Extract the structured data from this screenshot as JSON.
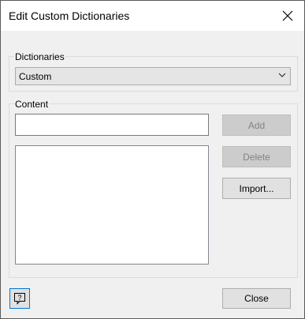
{
  "window": {
    "title": "Edit Custom Dictionaries",
    "close_icon": "close-icon"
  },
  "dictionaries": {
    "label": "Dictionaries",
    "selected": "Custom"
  },
  "content": {
    "label": "Content",
    "entry_value": "",
    "list_items": []
  },
  "buttons": {
    "add": "Add",
    "delete": "Delete",
    "import": "Import...",
    "close": "Close",
    "help_icon": "help-icon"
  },
  "colors": {
    "focus_accent": "#0078d7",
    "disabled_button": "#cccccc",
    "button_face": "#e1e1e1"
  }
}
